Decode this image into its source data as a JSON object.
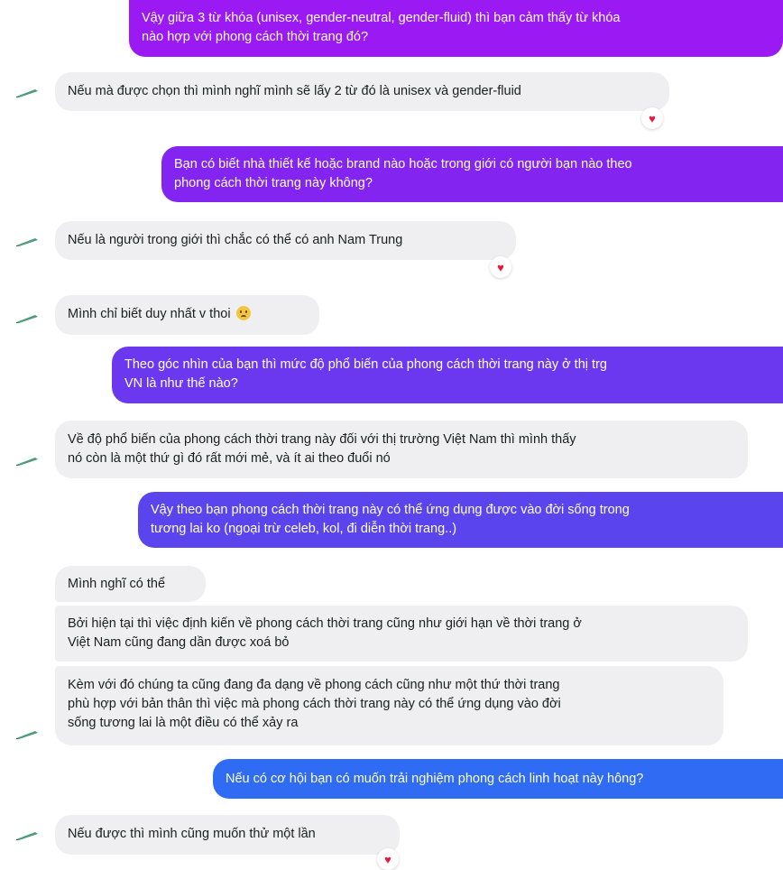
{
  "colors": {
    "sent_top": "#9b19f2",
    "sent_mid": "#7a2cf0",
    "sent_bottom": "#2f6bf3",
    "received_bg": "#efeff1",
    "heart": "#e8173b"
  },
  "avatar_icon": "pen-avatar-icon",
  "reaction_icon": "heart-icon",
  "messages": [
    {
      "lines": [
        "Vậy giữa 3 từ khóa (unisex, gender-neutral, gender-fluid) thì bạn cảm thấy từ khóa",
        "nào hợp với phong cách thời trang đó?"
      ]
    },
    {
      "lines": [
        "Nếu mà được chọn thì mình nghĩ mình sẽ lấy 2 từ đó là unisex và gender-fluid"
      ],
      "reaction": "♥"
    },
    {
      "lines": [
        "Bạn có biết nhà thiết kế hoặc brand nào hoặc trong giới có người bạn nào theo",
        "phong cách thời trang này không?"
      ]
    },
    {
      "lines": [
        "Nếu là người trong giới thì chắc có thể có anh Nam Trung"
      ],
      "reaction": "♥"
    },
    {
      "lines": [
        "Mình chỉ biết duy nhất v thoi"
      ],
      "emoji": "sad-face-emoji"
    },
    {
      "lines": [
        "Theo góc nhìn của bạn thì mức độ phổ biến của phong cách thời trang này ở thị trg",
        "VN  là như thế nào?"
      ]
    },
    {
      "lines": [
        "Về độ phổ biến của phong cách thời trang này đối với thị trường Việt Nam thì mình thấy",
        "nó còn là một thứ gì đó rất mới mẻ, và ít ai theo đuổi nó"
      ]
    },
    {
      "lines": [
        "Vậy theo bạn phong cách thời trang này có thể ứng dụng được vào đời sống trong",
        "tương lai ko (ngoại trừ celeb, kol, đi diễn thời trang..)"
      ]
    },
    {
      "lines": [
        "Mình nghĩ có thể"
      ]
    },
    {
      "lines": [
        "Bởi hiện tại thì việc định kiến về phong cách thời trang cũng như giới hạn về thời trang ở",
        "Việt Nam cũng đang dần được xoá bỏ"
      ]
    },
    {
      "lines": [
        "Kèm với đó chúng ta cũng đang đa dạng về phong cách cũng như một thứ thời trang",
        "phù hợp với bản thân thì việc mà phong cách thời trang này có thể ứng dụng vào đời",
        "sống tương lai là một điều có thể xảy ra"
      ]
    },
    {
      "lines": [
        "Nếu có cơ hội bạn có muốn trải nghiệm phong cách linh hoạt này hông?"
      ]
    },
    {
      "lines": [
        "Nếu được thì mình cũng muốn thử một lần"
      ],
      "reaction": "♥"
    }
  ]
}
